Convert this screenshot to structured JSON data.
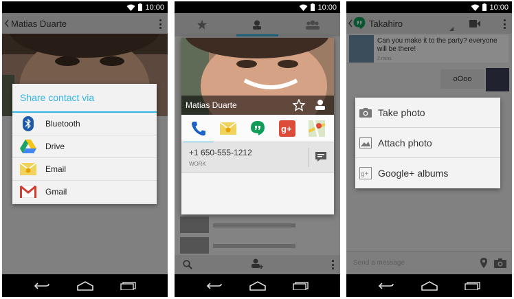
{
  "status": {
    "time": "10:00"
  },
  "screen1": {
    "contact_name": "Matias Duarte",
    "share_title": "Share contact via",
    "share_options": [
      {
        "label": "Bluetooth",
        "icon": "bluetooth-icon"
      },
      {
        "label": "Drive",
        "icon": "drive-icon"
      },
      {
        "label": "Email",
        "icon": "email-icon"
      },
      {
        "label": "Gmail",
        "icon": "gmail-icon"
      }
    ]
  },
  "screen2": {
    "tabs": [
      "favorites-tab",
      "contacts-tab",
      "groups-tab"
    ],
    "contact_name": "Matias Duarte",
    "apps": [
      "phone-icon",
      "email-icon",
      "hangouts-icon",
      "google-plus-icon",
      "maps-icon"
    ],
    "phone_number": "+1 650-555-1212",
    "phone_type": "WORK"
  },
  "screen3": {
    "contact_name": "Takahiro",
    "incoming_message": "Can you make it to the party? everyone will be there!",
    "incoming_time": "2 mins",
    "outgoing_message": "oOoo",
    "attach_options": [
      {
        "label": "Take photo",
        "icon": "camera-icon"
      },
      {
        "label": "Attach photo",
        "icon": "image-icon"
      },
      {
        "label": "Google+ albums",
        "icon": "google-plus-icon"
      }
    ],
    "compose_placeholder": "Send a message"
  },
  "colors": {
    "accent": "#33b5e5",
    "dialog_bg": "#f2f2f2",
    "status_bar": "#000000"
  }
}
